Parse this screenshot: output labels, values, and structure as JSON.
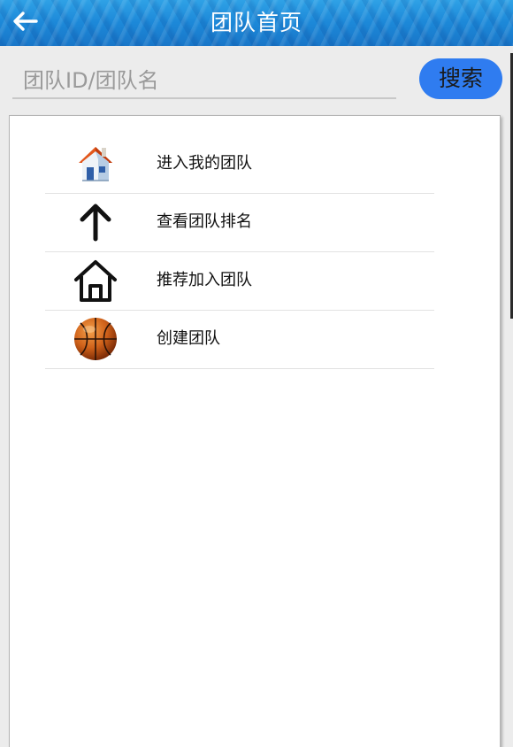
{
  "header": {
    "title": "团队首页",
    "back_icon": "arrow-left-icon"
  },
  "search": {
    "placeholder": "团队ID/团队名",
    "value": "",
    "button_label": "搜索"
  },
  "menu": {
    "items": [
      {
        "label": "进入我的团队",
        "icon": "house-color-icon"
      },
      {
        "label": "查看团队排名",
        "icon": "arrow-up-icon"
      },
      {
        "label": "推荐加入团队",
        "icon": "house-outline-icon"
      },
      {
        "label": "创建团队",
        "icon": "basketball-icon"
      }
    ]
  },
  "colors": {
    "header_blue": "#1c88d8",
    "search_button": "#2f7cf0",
    "background": "#ececec",
    "panel": "#ffffff"
  }
}
